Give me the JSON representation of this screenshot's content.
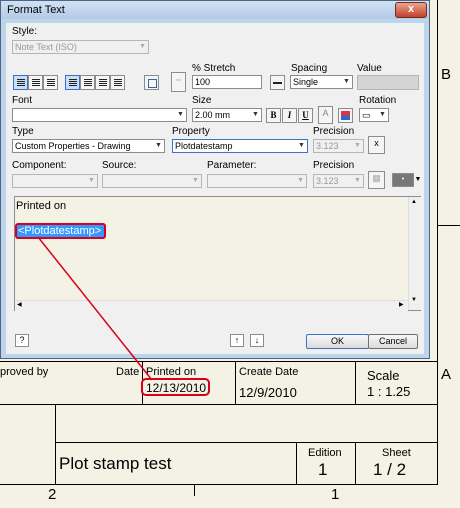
{
  "dialog": {
    "title": "Format Text",
    "close_glyph": "x",
    "style_label": "Style:",
    "style_value": "Note Text (ISO)",
    "stretch_label": "% Stretch",
    "stretch_value": "100",
    "spacing_label": "Spacing",
    "spacing_value": "Single",
    "value_label": "Value",
    "font_label": "Font",
    "size_label": "Size",
    "size_value": "2.00 mm",
    "bold_label": "B",
    "italic_label": "I",
    "underline_label": "U",
    "rotation_label": "Rotation",
    "type_label": "Type",
    "type_value": "Custom Properties - Drawing",
    "property_label": "Property",
    "property_value": "Plotdatestamp",
    "precision_label": "Precision",
    "precision_value": "3.123",
    "component_label": "Component:",
    "source_label": "Source:",
    "parameter_label": "Parameter:",
    "precision2_label": "Precision",
    "precision2_value": "3.123",
    "editor_line1": "Printed on",
    "editor_token": "<Plotdatestamp>",
    "help_glyph": "?",
    "ok_label": "OK",
    "cancel_label": "Cancel",
    "up_glyph": "↑",
    "down_glyph": "↓"
  },
  "drawing": {
    "zone_b": "B",
    "zone_a": "A",
    "approved_by": "proved by",
    "date_label": "Date",
    "printed_on_label": "Printed on",
    "printed_on_value": "12/13/2010",
    "create_date_label": "Create Date",
    "create_date_value": "12/9/2010",
    "scale_label": "Scale",
    "scale_value": "1 : 1.25",
    "title": "Plot stamp test",
    "edition_label": "Edition",
    "edition_value": "1",
    "sheet_label": "Sheet",
    "sheet_value": "1 / 2",
    "col_2": "2",
    "col_1": "1"
  },
  "colors": {
    "highlight": "#3399ff",
    "callout": "#d9001b",
    "paper": "#f4f2e4"
  }
}
